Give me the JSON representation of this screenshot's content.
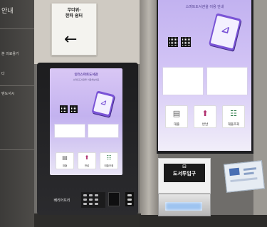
{
  "background_wall": {
    "left_edge_text": "안내",
    "left_wall_lines": [
      "분 의료용기",
      "다",
      "텐도서시"
    ]
  },
  "direction_sign": {
    "title_line1": "무더위·",
    "title_line2": "한파 쉼터",
    "subtitle": "",
    "arrow": "←"
  },
  "small_kiosk": {
    "screen": {
      "title": "인터스마트도서관",
      "subtitle": "스마트도서관을 이용해보세요",
      "buttons": [
        {
          "icon": "book-rack-icon",
          "label": "대출"
        },
        {
          "icon": "return-arrow-icon",
          "label": "반납"
        },
        {
          "icon": "list-icon",
          "label": "대출조회"
        }
      ]
    },
    "brand_label": "베리어프리"
  },
  "large_kiosk": {
    "screen": {
      "title": "스마트도서관을 이용 안내",
      "buttons": [
        {
          "icon": "book-rack-icon",
          "label": "대출"
        },
        {
          "icon": "return-arrow-icon",
          "label": "반납"
        },
        {
          "icon": "list-icon",
          "label": "대출조회"
        }
      ]
    }
  },
  "return_slot": {
    "sign_label": "도서투입구",
    "sign_icon": "book-drop-icon"
  },
  "colors": {
    "screen_purple": "#7a54d6",
    "kiosk_body": "#1d1d1f",
    "screen_bg_top": "#c3b2ef"
  }
}
